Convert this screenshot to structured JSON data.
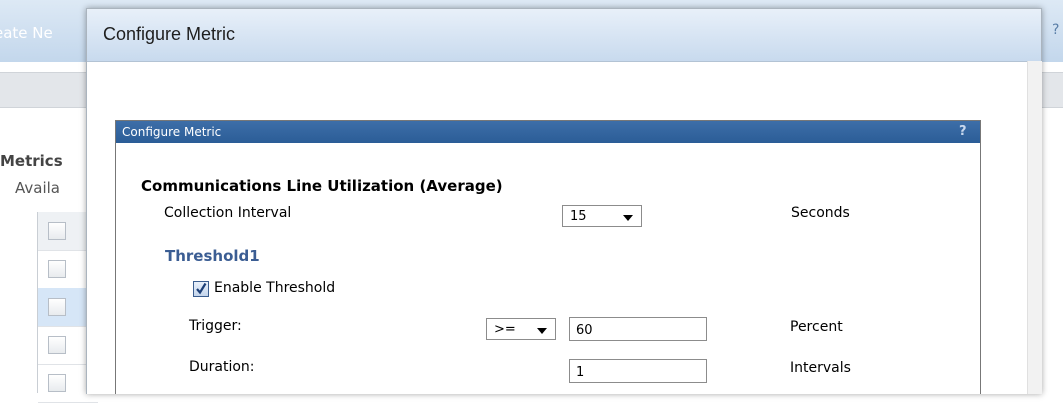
{
  "background": {
    "title_fragment": "eate Ne",
    "right_fragment": "?",
    "metrics_label": "Metrics",
    "available_label": "Availa"
  },
  "outer_dialog": {
    "title": "Configure Metric"
  },
  "inner_dialog": {
    "title": "Configure Metric",
    "help_label": "?",
    "metric_name": "Communications Line Utilization (Average)",
    "collection_interval": {
      "label": "Collection Interval",
      "value": "15",
      "unit": "Seconds"
    },
    "threshold": {
      "heading": "Threshold1",
      "enable_label": "Enable Threshold",
      "enabled": true,
      "trigger": {
        "label": "Trigger:",
        "operator": ">=",
        "value": "60",
        "unit": "Percent"
      },
      "duration": {
        "label": "Duration:",
        "value": "1",
        "unit": "Intervals"
      }
    }
  },
  "colors": {
    "inner_title_bar": "#2b5d97",
    "threshold_heading": "#3b5d93"
  }
}
